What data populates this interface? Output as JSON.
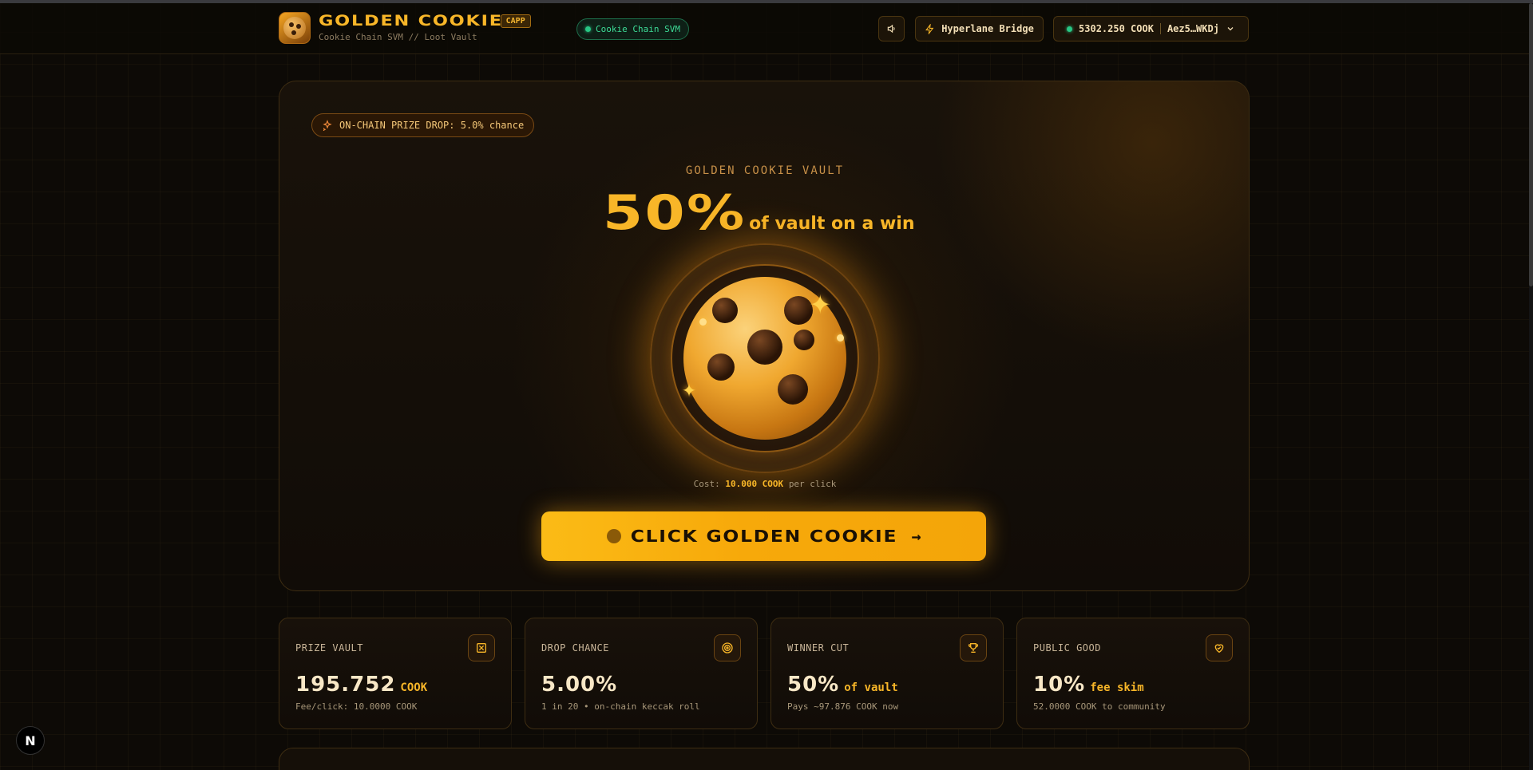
{
  "header": {
    "title": "GOLDEN COOKIE",
    "badge": "CAPP",
    "subtitle": "Cookie Chain SVM // Loot Vault",
    "chain_label": "Cookie Chain SVM",
    "bridge_label": "Hyperlane Bridge",
    "wallet_balance": "5302.250 COOK",
    "wallet_address": "Aez5…WKDj"
  },
  "hero": {
    "drop_pill": "ON-CHAIN PRIZE DROP: 5.0% chance",
    "eyebrow": "GOLDEN COOKIE VAULT",
    "headline_pct": "50%",
    "headline_text": "of vault on a win",
    "cost_prefix": "Cost:",
    "cost_value": "10.000 COOK",
    "cost_suffix": "per click",
    "cta_label": "CLICK GOLDEN COOKIE"
  },
  "stats": [
    {
      "label": "PRIZE VAULT",
      "value": "195.752",
      "unit": "COOK",
      "foot": "Fee/click: 10.0000 COOK",
      "icon": "vault-icon"
    },
    {
      "label": "DROP CHANCE",
      "value": "5.00%",
      "unit": "",
      "foot": "1 in 20 • on-chain keccak roll",
      "icon": "target-icon"
    },
    {
      "label": "WINNER CUT",
      "value": "50%",
      "unit": "of vault",
      "foot": "Pays ~97.876 COOK now",
      "icon": "trophy-icon"
    },
    {
      "label": "PUBLIC GOOD",
      "value": "10%",
      "unit": "fee skim",
      "foot": "52.0000 COOK to community",
      "icon": "heart-hand-icon"
    }
  ],
  "misc": {
    "next_badge": "N"
  },
  "colors": {
    "accent": "#f8b628",
    "background": "#0d0a06",
    "chain_green": "#3ddc97"
  }
}
